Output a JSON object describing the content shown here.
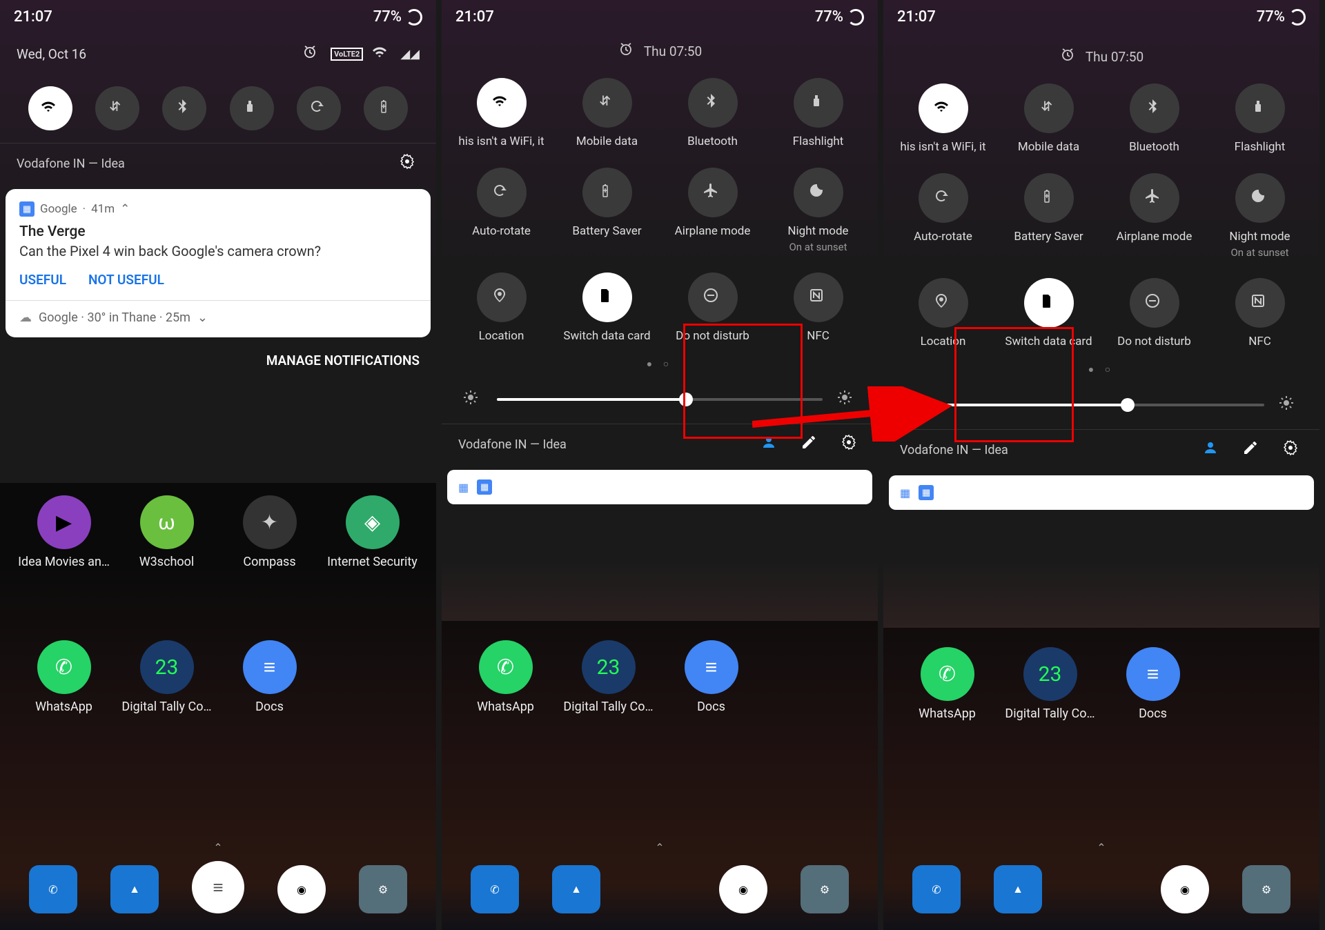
{
  "status": {
    "time": "21:07",
    "battery_pct": "77%"
  },
  "p1": {
    "date": "Wed, Oct 16",
    "carrier": "Vodafone IN — Idea",
    "tiles": [
      "wifi",
      "data",
      "bluetooth",
      "flashlight",
      "rotate",
      "battery"
    ],
    "notif": {
      "app": "Google",
      "age": "41m",
      "title": "The Verge",
      "body": "Can the Pixel 4 win back Google's camera crown?",
      "action_useful": "USEFUL",
      "action_not_useful": "NOT USEFUL",
      "weather": "Google  ·  30° in Thane  ·  25m"
    },
    "manage": "MANAGE NOTIFICATIONS",
    "apps_r1": [
      "Idea Movies an…",
      "W3school",
      "Compass",
      "Internet Security"
    ],
    "apps_r2": [
      "WhatsApp",
      "Digital Tally Co…",
      "Docs",
      ""
    ]
  },
  "p2": {
    "alarm": "Thu 07:50",
    "carrier": "Vodafone IN — Idea",
    "brightness_pct": 58,
    "tiles": [
      {
        "id": "wifi",
        "label": "his isn't a WiFi, it",
        "active": true
      },
      {
        "id": "data",
        "label": "Mobile data",
        "active": false
      },
      {
        "id": "bluetooth",
        "label": "Bluetooth",
        "active": false
      },
      {
        "id": "flashlight",
        "label": "Flashlight",
        "active": false
      },
      {
        "id": "rotate",
        "label": "Auto-rotate",
        "active": false
      },
      {
        "id": "battery",
        "label": "Battery Saver",
        "active": false
      },
      {
        "id": "airplane",
        "label": "Airplane mode",
        "active": false
      },
      {
        "id": "night",
        "label": "Night mode",
        "sub": "On at sunset",
        "active": false
      },
      {
        "id": "location",
        "label": "Location",
        "active": false
      },
      {
        "id": "switchcard",
        "label": "Switch data card",
        "active": true
      },
      {
        "id": "dnd",
        "label": "Do not disturb",
        "active": false
      },
      {
        "id": "nfc",
        "label": "NFC",
        "active": false
      }
    ],
    "apps_r2": [
      "WhatsApp",
      "Digital Tally Co…",
      "Docs",
      ""
    ]
  },
  "p3": {
    "alarm": "Thu 07:50",
    "carrier": "Vodafone IN — Idea",
    "brightness_pct": 58,
    "tiles": [
      {
        "id": "wifi",
        "label": "his isn't a WiFi, it",
        "active": true
      },
      {
        "id": "data",
        "label": "Mobile data",
        "active": false
      },
      {
        "id": "bluetooth",
        "label": "Bluetooth",
        "active": false
      },
      {
        "id": "flashlight",
        "label": "Flashlight",
        "active": false
      },
      {
        "id": "rotate",
        "label": "Auto-rotate",
        "active": false
      },
      {
        "id": "battery",
        "label": "Battery Saver",
        "active": false
      },
      {
        "id": "airplane",
        "label": "Airplane mode",
        "active": false
      },
      {
        "id": "night",
        "label": "Night mode",
        "sub": "On at sunset",
        "active": false
      },
      {
        "id": "location",
        "label": "Location",
        "active": false
      },
      {
        "id": "switchcard",
        "label": "Switch data card",
        "active": true
      },
      {
        "id": "dnd",
        "label": "Do not disturb",
        "active": false
      },
      {
        "id": "nfc",
        "label": "NFC",
        "active": false
      }
    ],
    "apps_r2": [
      "WhatsApp",
      "Digital Tally Co…",
      "Docs",
      ""
    ]
  },
  "icon_colors": {
    "idea": "#8a3fbf",
    "w3": "#6abf3f",
    "compass": "#333",
    "security": "#2faa6a",
    "whatsapp": "#25d366",
    "tally": "#1a3a6a",
    "docs": "#4285f4",
    "phone": "#1976d2",
    "photos": "#1976d2",
    "chrome": "#fff",
    "settings": "#546e7a"
  }
}
